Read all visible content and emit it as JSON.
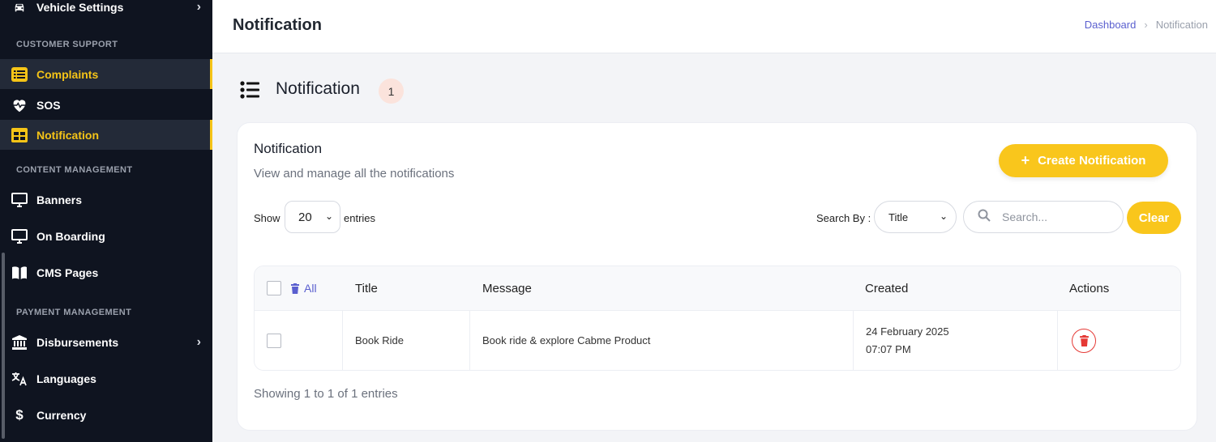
{
  "sidebar": {
    "items": [
      {
        "label": "Vehicle Settings",
        "icon": "car-icon"
      },
      {
        "label": "Complaints",
        "icon": "list-icon"
      },
      {
        "label": "SOS",
        "icon": "heart-pulse-icon"
      },
      {
        "label": "Notification",
        "icon": "table-icon"
      },
      {
        "label": "Banners",
        "icon": "monitor-icon"
      },
      {
        "label": "On Boarding",
        "icon": "monitor-icon"
      },
      {
        "label": "CMS Pages",
        "icon": "book-icon"
      },
      {
        "label": "Disbursements",
        "icon": "bank-icon"
      },
      {
        "label": "Languages",
        "icon": "translate-icon"
      },
      {
        "label": "Currency",
        "icon": "dollar-icon"
      }
    ],
    "sections": {
      "customer_support": "CUSTOMER SUPPORT",
      "content_management": "CONTENT MANAGEMENT",
      "payment_management": "PAYMENT MANAGEMENT"
    }
  },
  "header": {
    "title": "Notification",
    "breadcrumb": {
      "home": "Dashboard",
      "current": "Notification"
    }
  },
  "main": {
    "heading": "Notification",
    "count": "1",
    "card": {
      "title": "Notification",
      "subtitle": "View and manage all the notifications",
      "create_label": "Create Notification",
      "show_label": "Show",
      "entries_value": "20",
      "entries_label": "entries",
      "search_by_label": "Search By :",
      "search_by_value": "Title",
      "search_placeholder": "Search...",
      "clear_label": "Clear",
      "table": {
        "all_label": "All",
        "columns": [
          "Title",
          "Message",
          "Created",
          "Actions"
        ],
        "rows": [
          {
            "title": "Book Ride",
            "message": "Book ride & explore Cabme Product",
            "created_date": "24 February 2025",
            "created_time": "07:07 PM"
          }
        ]
      },
      "showing_text": "Showing 1 to 1 of 1 entries"
    }
  },
  "colors": {
    "accent": "#f9c61c",
    "sidebar_bg": "#0f1420",
    "active_text": "#f5c417",
    "link": "#5a5fcf",
    "danger": "#e53935"
  }
}
